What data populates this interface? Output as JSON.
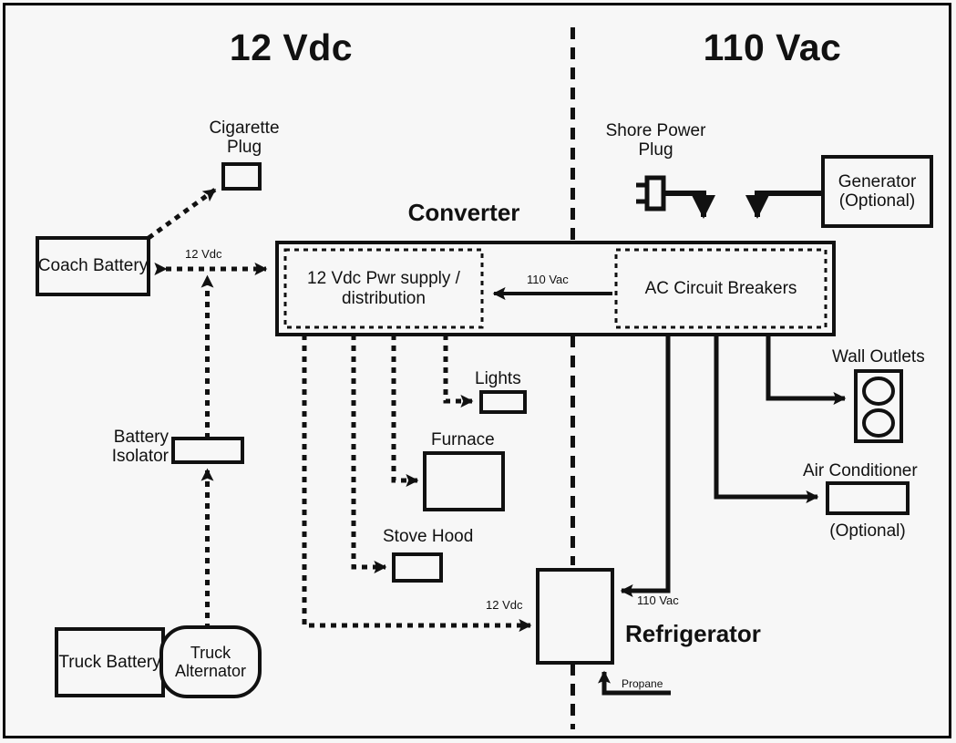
{
  "diagram": {
    "title_left": "12 Vdc",
    "title_right": "110 Vac",
    "converter_title": "Converter",
    "blocks": {
      "coach_battery": "Coach\nBattery",
      "cigarette_plug": "Cigarette\nPlug",
      "battery_isolator": "Battery\nIsolator",
      "truck_battery": "Truck\nBattery",
      "truck_alternator": "Truck\nAlternator",
      "dc_supply": "12 Vdc Pwr supply\n/ distribution",
      "ac_breakers": "AC Circuit Breakers",
      "lights": "Lights",
      "furnace": "Furnace",
      "stove_hood": "Stove Hood",
      "refrigerator": "Refrigerator",
      "shore_power_plug": "Shore Power\nPlug",
      "generator": "Generator\n(Optional)",
      "wall_outlets": "Wall Outlets",
      "air_conditioner": "Air Conditioner",
      "air_conditioner_optional": "(Optional)"
    },
    "wire_labels": {
      "dc_battery_link": "12 Vdc",
      "ac_to_dc": "110 Vac",
      "dc_to_fridge": "12 Vdc",
      "ac_to_fridge": "110 Vac",
      "propane": "Propane"
    },
    "colors": {
      "line": "#111111",
      "background": "#f7f7f7",
      "text": "#111111"
    }
  }
}
